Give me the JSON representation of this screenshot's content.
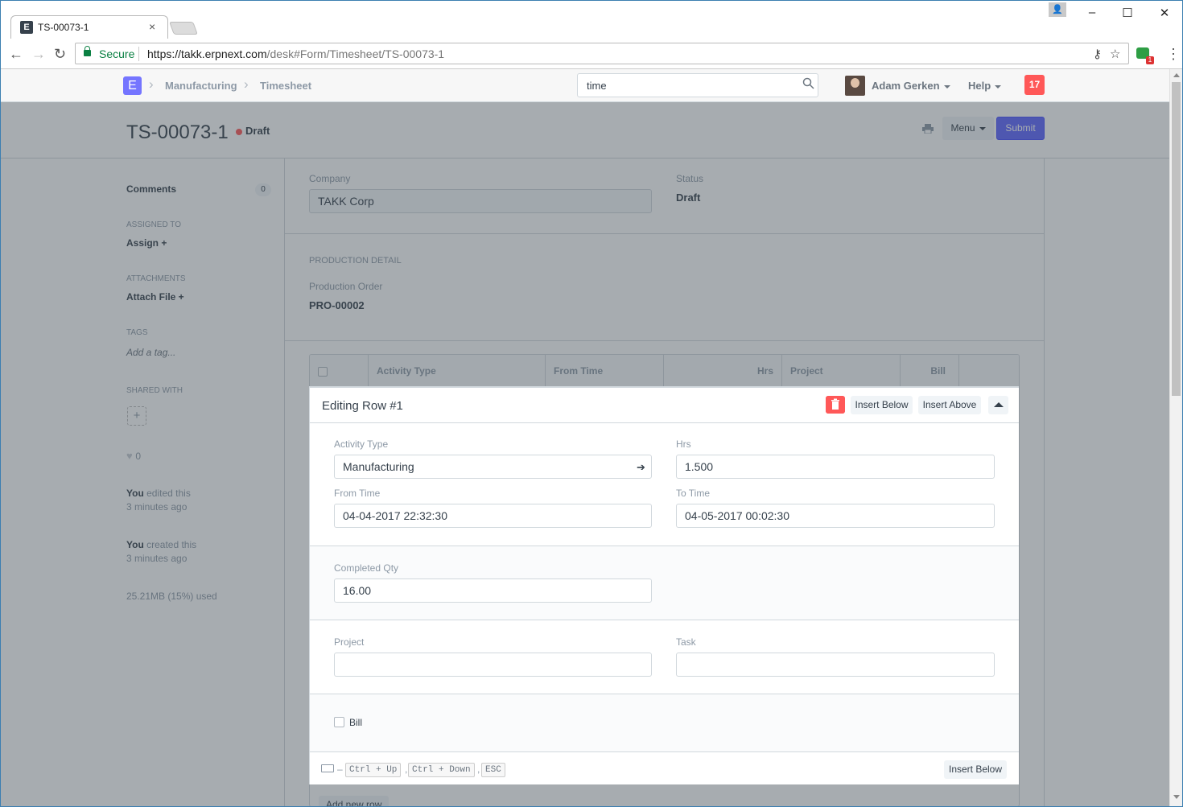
{
  "browser": {
    "tab_title": "TS-00073-1",
    "tab_favicon": "E",
    "secure_label": "Secure",
    "url_host": "https://takk.erpnext.com",
    "url_path": "/desk#Form/Timesheet/TS-00073-1",
    "extension_badge": "1"
  },
  "navbar": {
    "logo": "E",
    "breadcrumbs": [
      "Manufacturing",
      "Timesheet"
    ],
    "search_value": "time",
    "user_name": "Adam Gerken",
    "help_label": "Help",
    "notifications": "17"
  },
  "page": {
    "title": "TS-00073-1",
    "status": "Draft",
    "menu_label": "Menu",
    "submit_label": "Submit"
  },
  "sidebar": {
    "comments_label": "Comments",
    "comments_count": "0",
    "assigned_to_label": "ASSIGNED TO",
    "assign_label": "Assign +",
    "attachments_label": "ATTACHMENTS",
    "attach_label": "Attach File +",
    "tags_label": "TAGS",
    "add_tag": "Add a tag...",
    "shared_with_label": "SHARED WITH",
    "likes": "0",
    "timeline": [
      {
        "who": "You",
        "what": " edited this",
        "when": "3 minutes ago"
      },
      {
        "who": "You",
        "what": " created this",
        "when": "3 minutes ago"
      }
    ],
    "storage": "25.21MB (15%) used"
  },
  "form": {
    "company_label": "Company",
    "company_value": "TAKK Corp",
    "status_label": "Status",
    "status_value": "Draft",
    "production_section": "PRODUCTION DETAIL",
    "production_order_label": "Production Order",
    "production_order_value": "PRO-00002"
  },
  "grid": {
    "columns": [
      "Activity Type",
      "From Time",
      "Hrs",
      "Project",
      "Bill"
    ],
    "editing_title": "Editing Row #1",
    "insert_below": "Insert Below",
    "insert_above": "Insert Above",
    "fields": {
      "activity_type_label": "Activity Type",
      "activity_type_value": "Manufacturing",
      "hrs_label": "Hrs",
      "hrs_value": "1.500",
      "from_time_label": "From Time",
      "from_time_value": "04-04-2017 22:32:30",
      "to_time_label": "To Time",
      "to_time_value": "04-05-2017 00:02:30",
      "completed_qty_label": "Completed Qty",
      "completed_qty_value": "16.00",
      "project_label": "Project",
      "project_value": "",
      "task_label": "Task",
      "task_value": "",
      "bill_label": "Bill"
    },
    "shortcuts": [
      "Ctrl + Up",
      "Ctrl + Down",
      "ESC"
    ],
    "footer_insert_below": "Insert Below",
    "add_new_row": "Add new row"
  }
}
